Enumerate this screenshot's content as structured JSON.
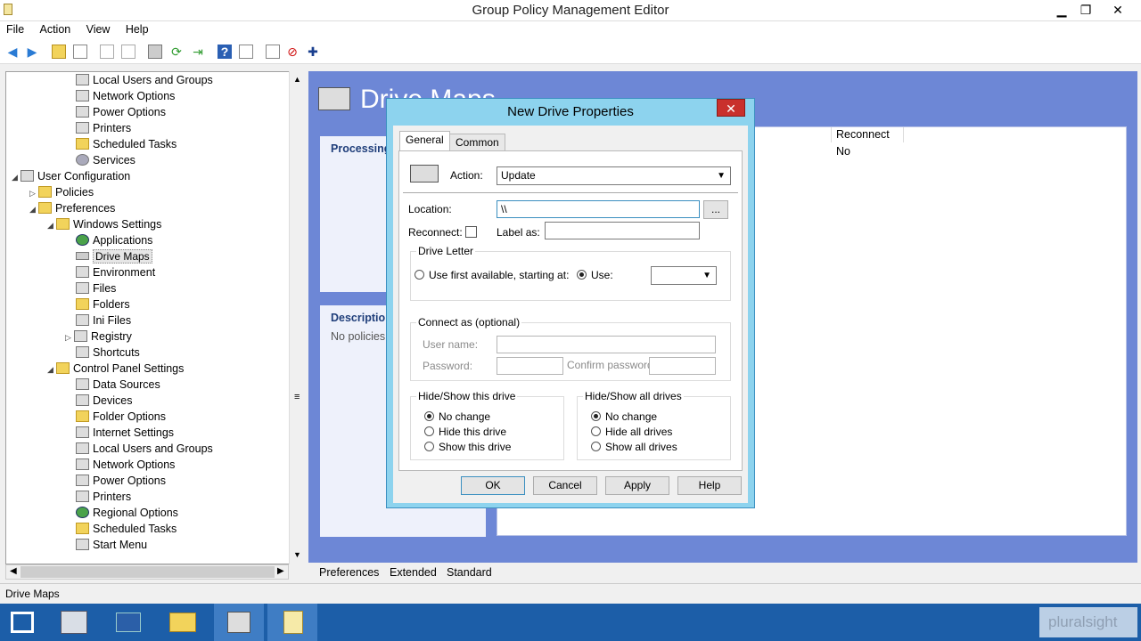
{
  "window": {
    "title": "Group Policy Management Editor",
    "minimize": "▁",
    "maximize": "❐",
    "close": "✕"
  },
  "menu": [
    "File",
    "Action",
    "View",
    "Help"
  ],
  "tree": {
    "items": [
      {
        "label": "Local Users and Groups"
      },
      {
        "label": "Network Options"
      },
      {
        "label": "Power Options"
      },
      {
        "label": "Printers"
      },
      {
        "label": "Scheduled Tasks"
      },
      {
        "label": "Services"
      },
      {
        "label": "User Configuration"
      },
      {
        "label": "Policies"
      },
      {
        "label": "Preferences"
      },
      {
        "label": "Windows Settings"
      },
      {
        "label": "Applications"
      },
      {
        "label": "Drive Maps"
      },
      {
        "label": "Environment"
      },
      {
        "label": "Files"
      },
      {
        "label": "Folders"
      },
      {
        "label": "Ini Files"
      },
      {
        "label": "Registry"
      },
      {
        "label": "Shortcuts"
      },
      {
        "label": "Control Panel Settings"
      },
      {
        "label": "Data Sources"
      },
      {
        "label": "Devices"
      },
      {
        "label": "Folder Options"
      },
      {
        "label": "Internet Settings"
      },
      {
        "label": "Local Users and Groups"
      },
      {
        "label": "Network Options"
      },
      {
        "label": "Power Options"
      },
      {
        "label": "Printers"
      },
      {
        "label": "Regional Options"
      },
      {
        "label": "Scheduled Tasks"
      },
      {
        "label": "Start Menu"
      }
    ]
  },
  "right": {
    "big_title": "Drive Maps",
    "processing": "Processing",
    "description": "Description",
    "no_policies": "No policies",
    "column_reconnect": "Reconnect",
    "cell_reconnect": "No"
  },
  "bottom_tabs": [
    "Preferences",
    "Extended",
    "Standard"
  ],
  "status": "Drive Maps",
  "watermark": "pluralsight",
  "dialog": {
    "title": "New Drive Properties",
    "close": "✕",
    "tabs": [
      "General",
      "Common"
    ],
    "action_label": "Action:",
    "action_value": "Update",
    "location_label": "Location:",
    "location_value": "\\\\",
    "browse": "...",
    "reconnect_label": "Reconnect:",
    "label_as": "Label as:",
    "drive_letter": {
      "title": "Drive Letter",
      "use_first": "Use first available, starting at:",
      "use": "Use:",
      "selected": "use"
    },
    "connect_as": {
      "title": "Connect as (optional)",
      "user_name": "User name:",
      "password": "Password:",
      "confirm_password": "Confirm password:"
    },
    "hide_show_this": {
      "title": "Hide/Show this drive",
      "options": [
        "No change",
        "Hide this drive",
        "Show this drive"
      ],
      "selected": 0
    },
    "hide_show_all": {
      "title": "Hide/Show all drives",
      "options": [
        "No change",
        "Hide all drives",
        "Show all drives"
      ],
      "selected": 0
    },
    "buttons": {
      "ok": "OK",
      "cancel": "Cancel",
      "apply": "Apply",
      "help": "Help"
    }
  }
}
